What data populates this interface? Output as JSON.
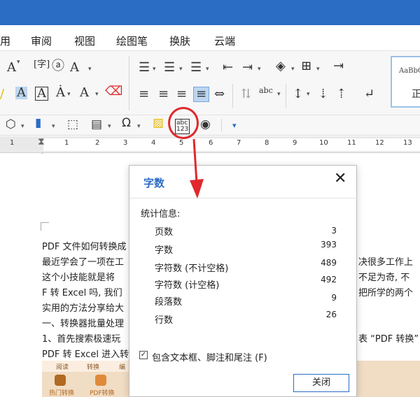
{
  "menu": [
    "用",
    "审阅",
    "视图",
    "绘图笔",
    "换肤",
    "云端"
  ],
  "ribbon": {
    "style_preview": "AaBbCc",
    "style_name": "正"
  },
  "ruler": {
    "ticks": [
      "1",
      "1",
      "2",
      "3",
      "4",
      "5",
      "6",
      "7",
      "8",
      "9",
      "10",
      "11",
      "12",
      "13"
    ]
  },
  "document": {
    "lines": [
      "PDF 文件如何转换成",
      "最近学会了一项在工",
      "这个小技能就是将",
      "F 转 Excel 吗, 我们",
      "实用的方法分享给大",
      "一、转换器批量处理",
      "1、首先搜索极速玩",
      "PDF 转 Excel 进入转"
    ],
    "right_fragments": [
      "决很多工作上",
      "不足为奇, 不",
      "把所学的两个",
      "表 “PDF 转换”"
    ]
  },
  "embedded_image": {
    "tabs": [
      "阅读",
      "转换",
      "编"
    ],
    "labels": [
      "热门转换",
      "PDF转换"
    ]
  },
  "dialog": {
    "title": "字数",
    "stats_heading": "统计信息:",
    "stats": [
      {
        "label": "页数",
        "value": "3"
      },
      {
        "label": "字数",
        "value": "393"
      },
      {
        "label": "字符数 (不计空格)",
        "value": "489"
      },
      {
        "label": "字符数 (计空格)",
        "value": "492"
      },
      {
        "label": "段落数",
        "value": "9"
      },
      {
        "label": "行数",
        "value": "26"
      }
    ],
    "checkbox_label": "包含文本框、脚注和尾注  (F)",
    "checkbox_checked": "✓",
    "close_button": "关闭"
  },
  "colors": {
    "accent": "#2b6cc4",
    "annotation": "#e0282c"
  }
}
